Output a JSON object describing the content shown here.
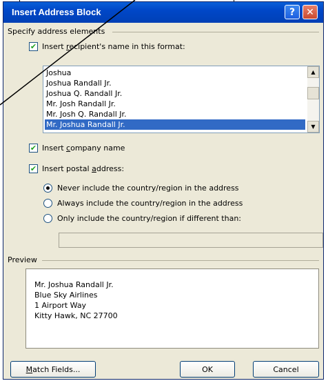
{
  "dialog": {
    "title": "Insert Address Block",
    "help_icon": "help-icon",
    "close_icon": "close-icon"
  },
  "address_elements": {
    "group_label": "Specify address elements",
    "recipient_name_checkbox": {
      "checked": true,
      "label": "Insert recipient's name in this format:"
    },
    "name_formats": [
      "Joshua",
      "Joshua Randall Jr.",
      "Joshua Q. Randall Jr.",
      "Mr. Josh Randall Jr.",
      "Mr. Josh Q. Randall Jr.",
      "Mr. Joshua Randall Jr."
    ],
    "selected_format": "Mr. Joshua Randall Jr.",
    "company_checkbox": {
      "checked": true,
      "label": "Insert company name"
    },
    "postal_checkbox": {
      "checked": true,
      "label": "Insert postal address:"
    },
    "country_options": [
      {
        "label": "Never include the country/region in the address",
        "selected": true
      },
      {
        "label": "Always include the country/region in the address",
        "selected": false
      },
      {
        "label": "Only include the country/region if different than:",
        "selected": false
      }
    ],
    "country_value": ""
  },
  "preview": {
    "group_label": "Preview",
    "lines": [
      "Mr. Joshua Randall Jr.",
      "Blue Sky Airlines",
      "1 Airport Way",
      "Kitty Hawk, NC 27700"
    ]
  },
  "buttons": {
    "match_fields": "Match Fields...",
    "ok": "OK",
    "cancel": "Cancel"
  },
  "colors": {
    "titlebar": "#0047c8",
    "dialog_bg": "#ece9d8",
    "selection": "#316ac5",
    "check_mark": "#21a121"
  }
}
